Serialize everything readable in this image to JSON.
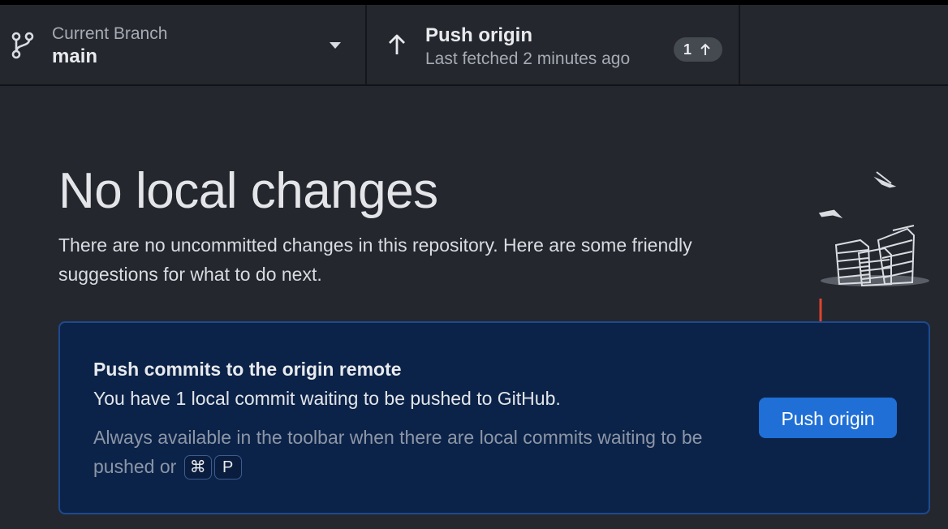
{
  "toolbar": {
    "branch": {
      "label": "Current Branch",
      "value": "main",
      "icon": "git-branch-icon"
    },
    "push": {
      "title": "Push origin",
      "subtitle": "Last fetched 2 minutes ago",
      "badge_count": "1",
      "icon": "arrow-up-icon"
    }
  },
  "main": {
    "heading": "No local changes",
    "description": "There are no uncommitted changes in this repository. Here are some friendly suggestions for what to do next."
  },
  "suggestion": {
    "title": "Push commits to the origin remote",
    "description": "You have 1 local commit waiting to be pushed to GitHub.",
    "hint": "Always available in the toolbar when there are local commits waiting to be pushed or",
    "shortcut_keys": [
      "⌘",
      "P"
    ],
    "button_label": "Push origin"
  },
  "colors": {
    "background": "#24272e",
    "card_background": "#0c2349",
    "card_border": "#1d4a8f",
    "button": "#1f6fd6",
    "annotation_arrow": "#e0432f"
  }
}
